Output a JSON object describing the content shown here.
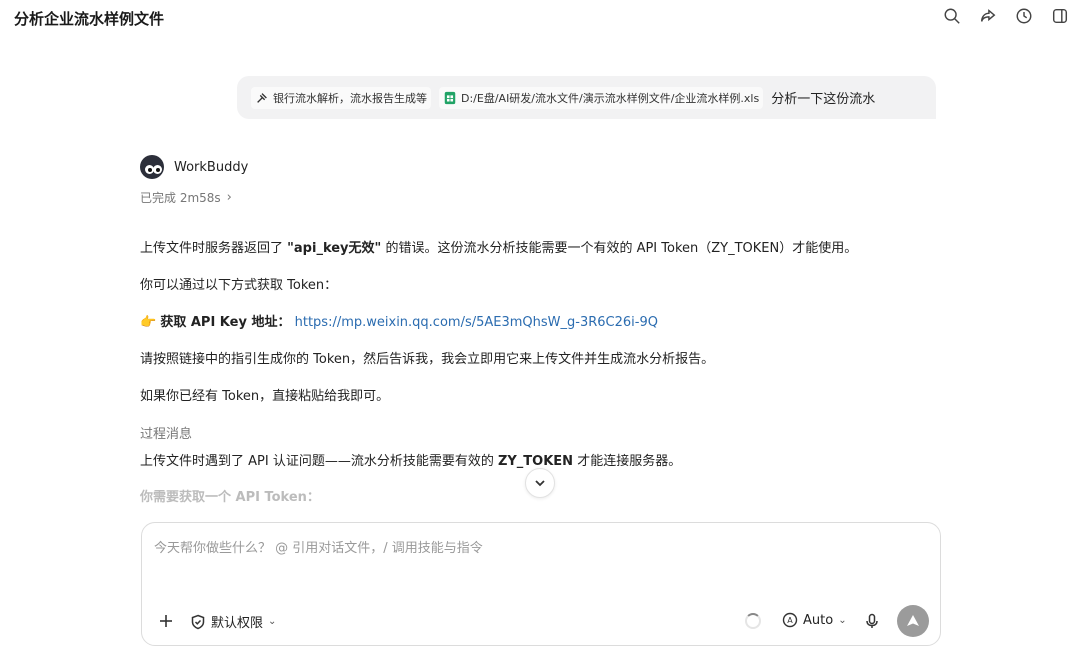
{
  "app": {
    "title": "分析企业流水样例文件"
  },
  "user_message": {
    "skill_chip": "银行流水解析，流水报告生成等",
    "file_chip": "D:/E盘/AI研发/流水文件/演示流水样例文件/企业流水样例.xls",
    "text": "分析一下这份流水"
  },
  "bot": {
    "name": "WorkBuddy",
    "status": "已完成 2m58s",
    "p1_pre": "上传文件时服务器返回了 ",
    "p1_bold": "\"api_key无效\"",
    "p1_post": " 的错误。这份流水分析技能需要一个有效的 API Token（ZY_TOKEN）才能使用。",
    "p2": "你可以通过以下方式获取 Token：",
    "p3_emoji": "👉",
    "p3_bold": "获取 API Key 地址：",
    "p3_link": "https://mp.weixin.qq.com/s/5AE3mQhsW_g-3R6C26i-9Q",
    "p4": "请按照链接中的指引生成你的 Token，然后告诉我，我会立即用它来上传文件并生成流水分析报告。",
    "p5": "如果你已经有 Token，直接粘贴给我即可。",
    "process_label": "过程消息",
    "p6_pre": "上传文件时遇到了 API 认证问题——流水分析技能需要有效的 ",
    "p6_bold": "ZY_TOKEN",
    "p6_post": " 才能连接服务器。",
    "p7": "你需要获取一个 API Token："
  },
  "composer": {
    "placeholder": "今天帮你做些什么？ @ 引用对话文件，/ 调用技能与指令",
    "permission_label": "默认权限",
    "model_label": "Auto"
  }
}
